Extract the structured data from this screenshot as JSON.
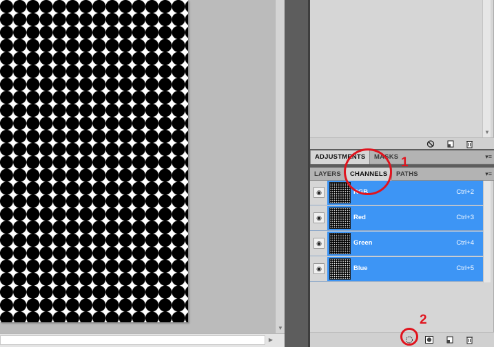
{
  "document": {
    "pattern": "black-circles-on-white"
  },
  "panels": {
    "adjustments_group": {
      "tabs": [
        {
          "label": "ADJUSTMENTS",
          "active": true
        },
        {
          "label": "MASKS",
          "active": false
        }
      ],
      "menu_icon": "panel-menu-icon"
    },
    "layers_group": {
      "tabs": [
        {
          "label": "LAYERS",
          "active": false
        },
        {
          "label": "CHANNELS",
          "active": true
        },
        {
          "label": "PATHS",
          "active": false
        }
      ],
      "menu_icon": "panel-menu-icon"
    },
    "channels": [
      {
        "name": "RGB",
        "shortcut": "Ctrl+2",
        "visible": true,
        "selected": true
      },
      {
        "name": "Red",
        "shortcut": "Ctrl+3",
        "visible": true,
        "selected": true
      },
      {
        "name": "Green",
        "shortcut": "Ctrl+4",
        "visible": true,
        "selected": true
      },
      {
        "name": "Blue",
        "shortcut": "Ctrl+5",
        "visible": true,
        "selected": true
      }
    ],
    "channels_footer_icons": [
      "load-channel-as-selection-icon",
      "save-selection-as-channel-icon",
      "new-channel-icon",
      "delete-channel-icon"
    ],
    "adjustments_footer_icons": [
      "no-entry-icon",
      "new-icon",
      "trash-icon"
    ]
  },
  "annotations": {
    "one": "1",
    "two": "2",
    "color": "#e0141e"
  },
  "colors": {
    "selection": "#3d95f5",
    "panel_bg": "#d6d6d6",
    "strip": "#5d5d5d"
  }
}
